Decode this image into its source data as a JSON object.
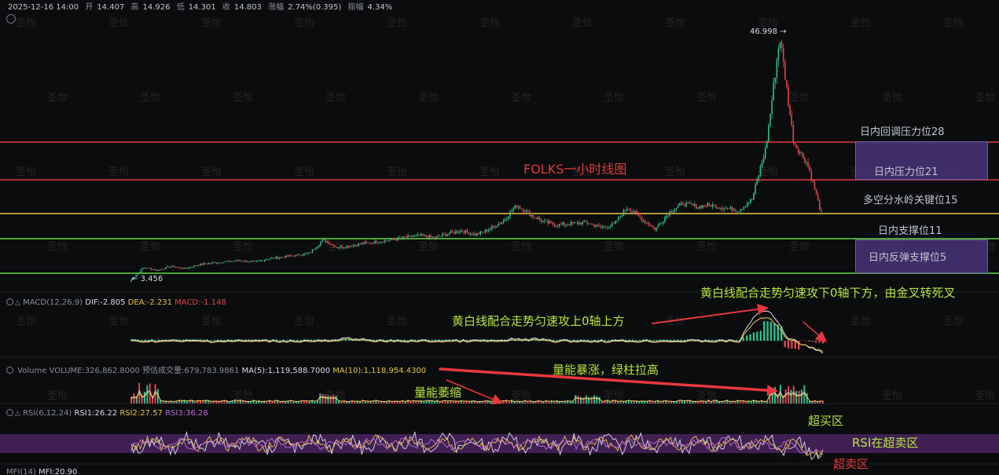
{
  "header": {
    "datetime": "2025-12-16 14:00",
    "open_label": "开",
    "open": "14.407",
    "high_label": "高",
    "high": "14.926",
    "low_label": "低",
    "low": "14.301",
    "close_label": "收",
    "close": "14.803",
    "change_label": "涨幅",
    "change": "2.74%(0.395)",
    "amplitude_label": "振幅",
    "amplitude": "4.34%"
  },
  "watermark": "圣怡",
  "title": "FOLKS一小时线图",
  "price_extremes": {
    "high": "46.998",
    "low": "3.456"
  },
  "levels": [
    {
      "label": "日内回调压力位28",
      "color": "#e03a3a"
    },
    {
      "label": "日内压力位21",
      "color": "#e03a3a"
    },
    {
      "label": "多空分水岭关键位15",
      "color": "#e8c547"
    },
    {
      "label": "日内支撑位11",
      "color": "#62d444"
    },
    {
      "label": "日内反弹支撑位5",
      "color": "#62d444"
    }
  ],
  "macd": {
    "name": "MACD(12,26,9)",
    "dif": "DIF:-2.805",
    "dea": "DEA:-2.231",
    "macd": "MACD:-1.148",
    "annotation_left": "黄白线配合走势匀速攻上0轴上方",
    "annotation_right": "黄白线配合走势匀速攻下0轴下方，由金叉转死叉"
  },
  "volume": {
    "name": "Volume",
    "volume": "VOLUME:326,862.8000",
    "est": "预估成交量:679,783.9861",
    "ma5": "MA(5):1,119,588.7000",
    "ma10": "MA(10):1,118,954.4300",
    "annotation_shrink": "量能萎缩",
    "annotation_surge": "量能暴涨，绿柱拉高"
  },
  "rsi": {
    "name": "RSI(6,12,24)",
    "rsi1": "RSI1:26.22",
    "rsi2": "RSI2:27.57",
    "rsi3": "RSI3:36.28",
    "overbought": "超买区",
    "status": "RSI在超卖区",
    "oversold": "超卖区"
  },
  "mfi": {
    "name": "MFI(14)",
    "value": "MFI:20.90"
  },
  "colors": {
    "up": "#2fbf8f",
    "down": "#e0464b",
    "red_line": "#e03a3a",
    "yellow_line": "#e8c547",
    "green_line": "#62d444",
    "annotation": "#b5e63c",
    "box": "#4a3478"
  },
  "chart_data": {
    "type": "line",
    "title": "FOLKS一小时线图",
    "x": [
      0,
      2,
      4,
      6,
      8,
      10,
      12,
      14,
      16,
      18,
      20,
      22,
      24,
      26,
      28,
      30,
      32,
      34,
      36,
      38,
      40,
      42,
      44,
      46,
      48,
      50,
      52,
      54,
      56,
      58,
      60,
      62,
      64,
      66,
      68,
      70,
      72,
      74,
      76,
      78,
      80,
      82,
      84,
      86,
      88,
      90,
      92,
      94,
      96,
      98,
      100
    ],
    "series": [
      {
        "values": [
          3.5,
          6,
          5.5,
          6.2,
          5.8,
          6.5,
          6.8,
          7,
          7.2,
          6.9,
          7.5,
          7.8,
          8.1,
          8.5,
          10.8,
          9.5,
          9.8,
          10.2,
          10.5,
          10.8,
          11.2,
          11.5,
          11.1,
          11.8,
          12.3,
          11.6,
          12.5,
          13.8,
          16.5,
          14.8,
          13.6,
          13.2,
          13.4,
          13.6,
          12.8,
          13.2,
          16.2,
          14.2,
          12.5,
          15.2,
          16.8,
          16.2,
          16.5,
          16,
          15.6,
          17.5,
          27,
          46.998,
          28,
          24,
          15
        ]
      }
    ],
    "levels": [
      28,
      21,
      15,
      11,
      5
    ],
    "ylim": [
      3,
      49
    ],
    "annotations": [
      "46.998",
      "3.456"
    ]
  }
}
